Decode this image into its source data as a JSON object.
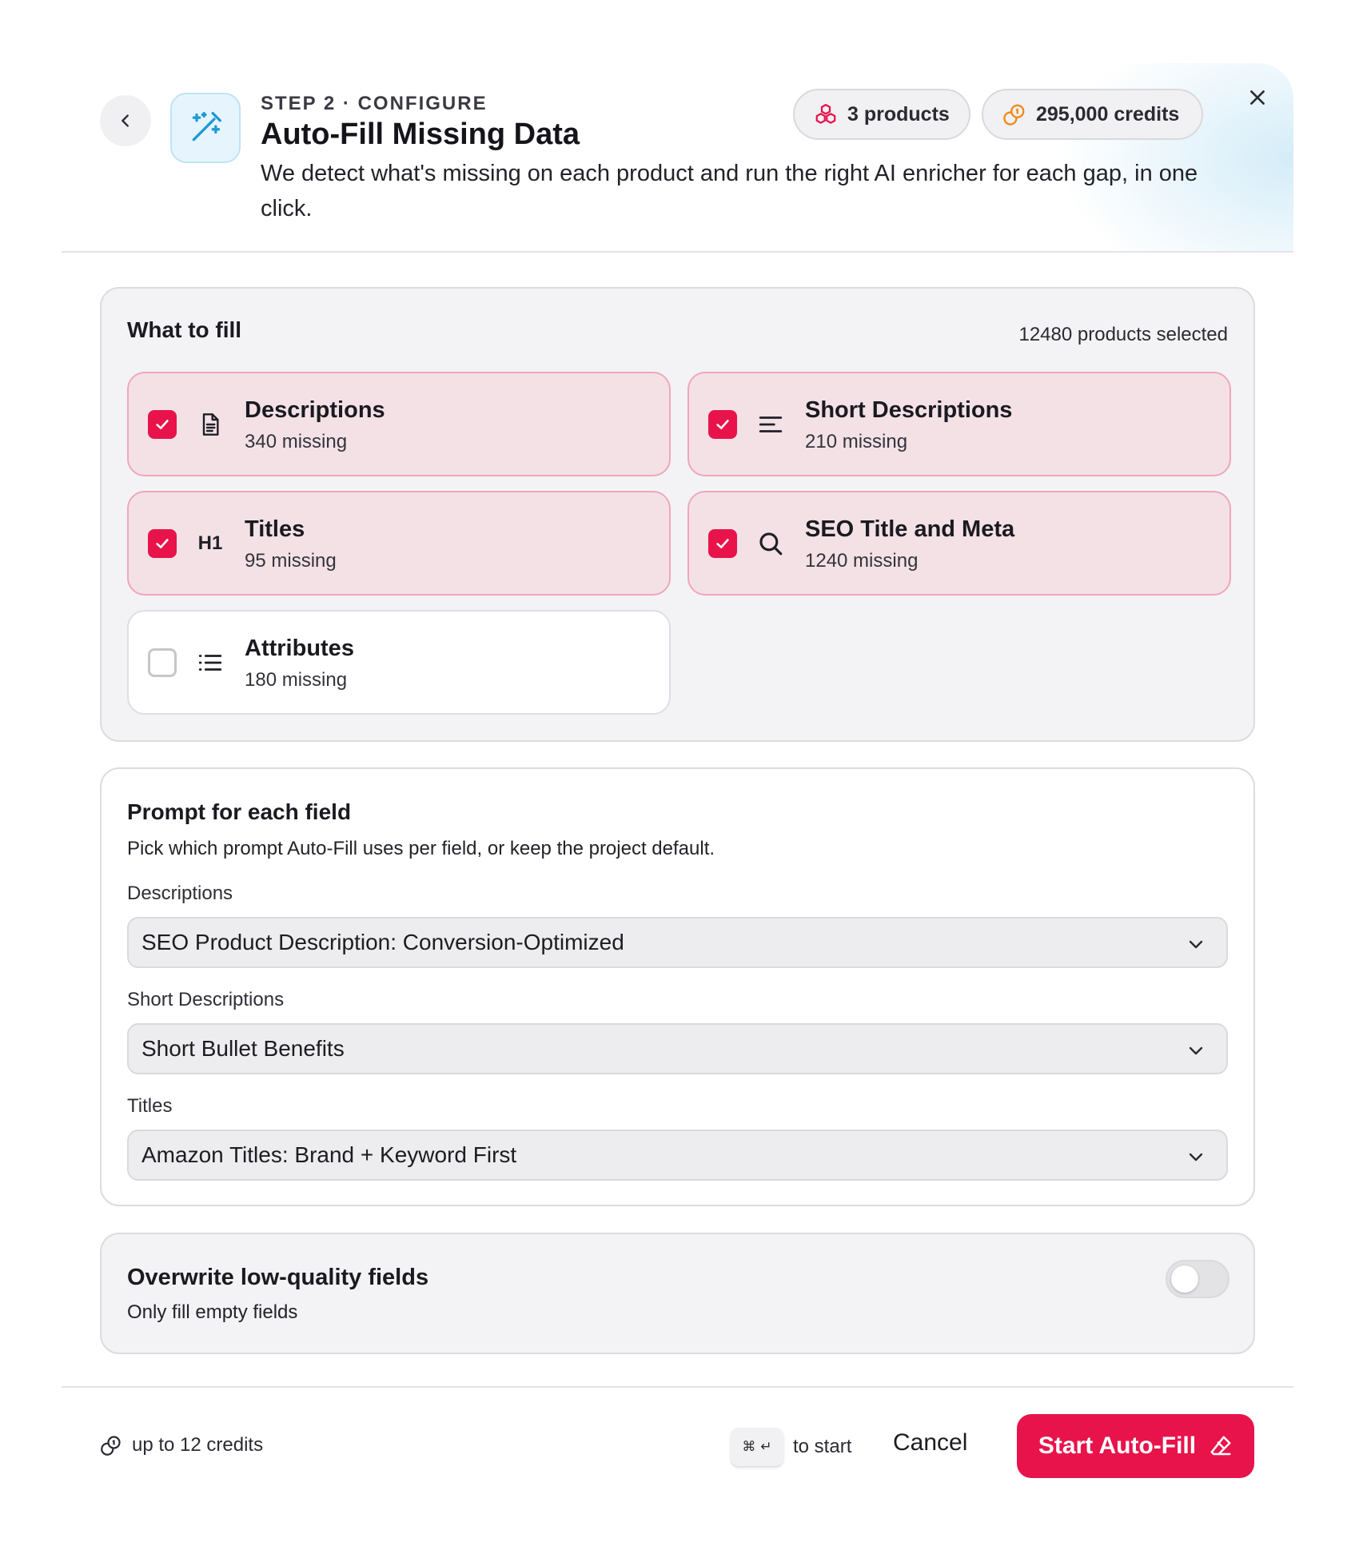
{
  "header": {
    "step_label": "STEP 2 · CONFIGURE",
    "title": "Auto-Fill Missing Data",
    "description": "We detect what's missing on each product and run the right AI enricher for each gap, in one click.",
    "products_pill": "3 products",
    "credits_pill": "295,000 credits"
  },
  "what_to_fill": {
    "title": "What to fill",
    "selected_count": "12480 products selected",
    "fields": [
      {
        "name": "Descriptions",
        "missing": "340 missing",
        "checked": true,
        "icon": "document-icon"
      },
      {
        "name": "Short Descriptions",
        "missing": "210 missing",
        "checked": true,
        "icon": "align-left-icon"
      },
      {
        "name": "Titles",
        "missing": "95 missing",
        "checked": true,
        "icon": "heading-icon",
        "icon_text": "H1"
      },
      {
        "name": "SEO Title and Meta",
        "missing": "1240 missing",
        "checked": true,
        "icon": "search-icon"
      },
      {
        "name": "Attributes",
        "missing": "180 missing",
        "checked": false,
        "icon": "list-icon"
      }
    ]
  },
  "prompts": {
    "title": "Prompt for each field",
    "subtitle": "Pick which prompt Auto-Fill uses per field, or keep the project default.",
    "selects": [
      {
        "label": "Descriptions",
        "value": "SEO Product Description: Conversion-Optimized"
      },
      {
        "label": "Short Descriptions",
        "value": "Short Bullet Benefits"
      },
      {
        "label": "Titles",
        "value": "Amazon Titles: Brand + Keyword First"
      }
    ]
  },
  "overwrite": {
    "title": "Overwrite low-quality fields",
    "subtitle": "Only fill empty fields",
    "enabled": false
  },
  "footer": {
    "credits_note": "up to 12 credits",
    "shortcut_hint": "to start",
    "cancel_label": "Cancel",
    "start_label": "Start Auto-Fill"
  },
  "colors": {
    "accent": "#e8134a",
    "checked_card_bg": "#f3e1e6",
    "checked_card_border": "#f0a7b9",
    "wand_box_bg": "#e6f5fd",
    "wand_color": "#1e9ad6",
    "credits_icon_color": "#f08a1c"
  }
}
